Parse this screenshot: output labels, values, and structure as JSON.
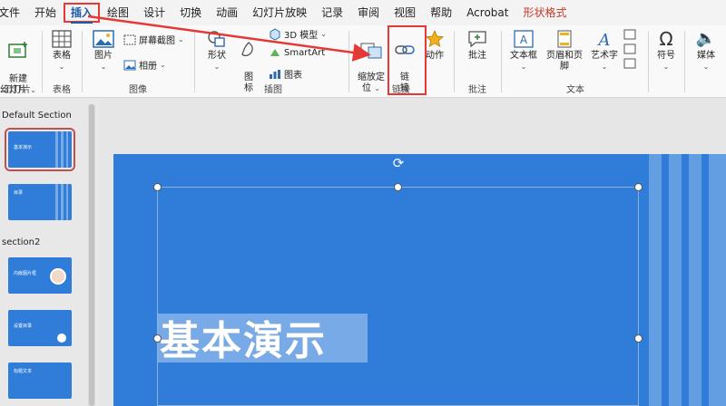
{
  "tabs": [
    "文件",
    "开始",
    "插入",
    "绘图",
    "设计",
    "切换",
    "动画",
    "幻灯片放映",
    "记录",
    "审阅",
    "视图",
    "帮助",
    "Acrobat",
    "形状格式"
  ],
  "active_tab": "插入",
  "ribbon": {
    "slides_group": {
      "new_slide": "新建\n幻灯片",
      "label": "幻灯片"
    },
    "tables_group": {
      "table": "表格",
      "label": "表格"
    },
    "images_group": {
      "pictures": "图片",
      "screenshot": "屏幕截图",
      "album": "相册",
      "label": "图像"
    },
    "illustrations_group": {
      "shapes": "形状",
      "icons": "图\n标",
      "models3d": "3D 模型",
      "smartart": "SmartArt",
      "chart": "图表",
      "label": "插图"
    },
    "links_group": {
      "zoom": "缩放定\n位",
      "link": "链\n接",
      "action": "动作",
      "label": "链接"
    },
    "comments_group": {
      "comment": "批注",
      "label": "批注"
    },
    "text_group": {
      "textbox": "文本框",
      "header_footer": "页眉和页脚",
      "wordart": "艺术字",
      "label": "文本"
    },
    "symbols_group": {
      "symbol": "符号"
    },
    "media_group": {
      "media": "媒体"
    }
  },
  "thumbnails": {
    "section1": "Default Section",
    "section2": "section2",
    "slides": [
      {
        "text": "基本演示"
      },
      {
        "text": "目录"
      },
      {
        "text": "内嵌图片框"
      },
      {
        "text": "设置目录"
      },
      {
        "text": "标题文本"
      }
    ]
  },
  "slide": {
    "title": "基本演示"
  },
  "colors": {
    "slide_bg": "#2f7dd9",
    "highlight": "#e53935",
    "active_tab": "#1f5aa6"
  }
}
